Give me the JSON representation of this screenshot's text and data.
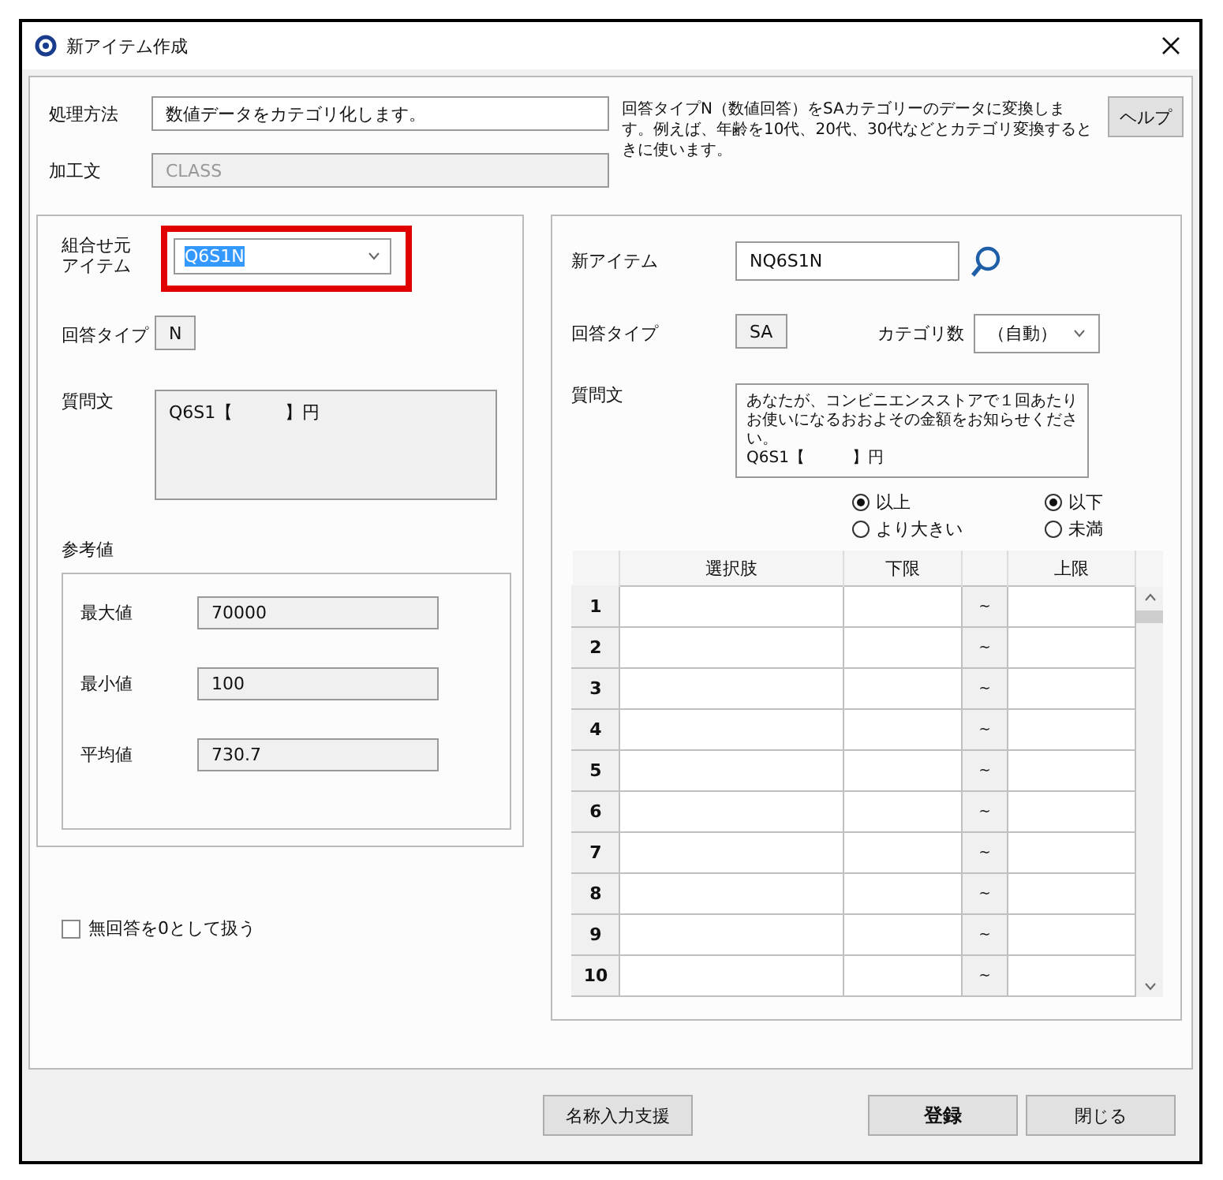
{
  "window": {
    "title": "新アイテム作成"
  },
  "processing": {
    "label": "処理方法",
    "value": "数値データをカテゴリ化します。",
    "readonly": false,
    "disabled": false
  },
  "expression": {
    "label": "加工文",
    "value": "CLASS",
    "readonly": true,
    "disabled": true
  },
  "description": "回答タイプN（数値回答）をSAカテゴリーのデータに変換します。例えば、年齢を10代、20代、30代などとカテゴリ変換するときに使います。",
  "help_button": "ヘルプ",
  "source": {
    "item_label": "組合せ元アイテム",
    "item_value": "Q6S1N",
    "highlighted": true,
    "text_selected": true,
    "answer_type": {
      "label": "回答タイプ",
      "value": "N",
      "readonly": true,
      "disabled": false
    },
    "question": {
      "label": "質問文",
      "value": "Q6S1【　　　】円",
      "readonly": true
    },
    "reference": {
      "label": "参考値",
      "values": [
        {
          "label": "最大値",
          "value": "70000"
        },
        {
          "label": "最小値",
          "value": "100"
        },
        {
          "label": "平均値",
          "value": "730.7"
        }
      ]
    },
    "zero_checkbox": {
      "label": "無回答を0として扱う",
      "checked": false
    }
  },
  "target": {
    "item_label": "新アイテム",
    "item_value": "NQ6S1N",
    "answer_type": {
      "label": "回答タイプ",
      "value": "SA",
      "readonly": true,
      "disabled": false
    },
    "category_count": {
      "label": "カテゴリ数",
      "value": "（自動）"
    },
    "question": {
      "label": "質問文",
      "value": "あなたが、コンビニエンスストアで１回あたりお使いになるおおよその金額をお知らせください。\nQ6S1【　　　】円",
      "readonly": false
    },
    "lower_options": [
      {
        "label": "以上",
        "selected": true
      },
      {
        "label": "より大きい",
        "selected": false
      }
    ],
    "upper_options": [
      {
        "label": "以下",
        "selected": true
      },
      {
        "label": "未満",
        "selected": false
      }
    ],
    "table": {
      "columns": [
        "選択肢",
        "下限",
        "上限"
      ],
      "rows": [
        {
          "number": "1",
          "separator": "~"
        },
        {
          "number": "2",
          "separator": "~"
        },
        {
          "number": "3",
          "separator": "~"
        },
        {
          "number": "4",
          "separator": "~"
        },
        {
          "number": "5",
          "separator": "~"
        },
        {
          "number": "6",
          "separator": "~"
        },
        {
          "number": "7",
          "separator": "~"
        },
        {
          "number": "8",
          "separator": "~"
        },
        {
          "number": "9",
          "separator": "~"
        },
        {
          "number": "10",
          "separator": "~"
        }
      ]
    }
  },
  "footer_buttons": [
    {
      "label": "名称入力支援",
      "kind": "normal"
    },
    {
      "label": "登録",
      "kind": "primary"
    },
    {
      "label": "閉じる",
      "kind": "normal"
    }
  ]
}
